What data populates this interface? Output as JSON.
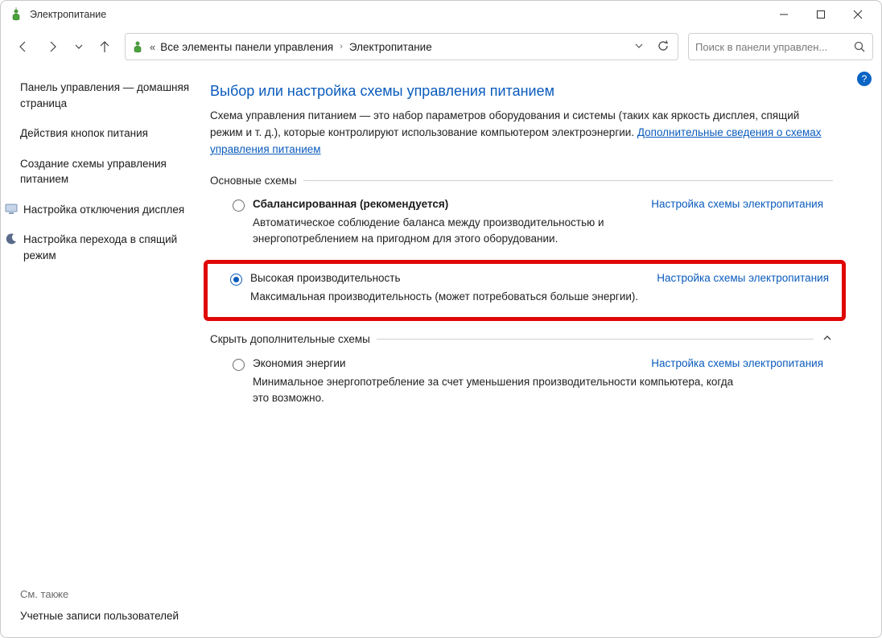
{
  "title": "Электропитание",
  "breadcrumb": {
    "prefix": "«",
    "level1": "Все элементы панели управления",
    "level2": "Электропитание"
  },
  "search": {
    "placeholder": "Поиск в панели управлен..."
  },
  "help_badge": "?",
  "sidebar": {
    "items": [
      {
        "label": "Панель управления — домашняя страница"
      },
      {
        "label": "Действия кнопок питания"
      },
      {
        "label": "Создание схемы управления питанием"
      },
      {
        "label": "Настройка отключения дисплея",
        "icon": "monitor"
      },
      {
        "label": "Настройка перехода в спящий режим",
        "icon": "moon"
      }
    ],
    "see_also_h": "См. также",
    "see_also": "Учетные записи пользователей"
  },
  "page": {
    "title": "Выбор или настройка схемы управления питанием",
    "desc": "Схема управления питанием — это набор параметров оборудования и системы (таких как яркость дисплея, спящий режим и т. д.), которые контролируют использование компьютером электроэнергии.",
    "more_link": "Дополнительные сведения о схемах управления питанием",
    "section1": "Основные схемы",
    "plan_link": "Настройка схемы электропитания",
    "plans": {
      "balanced": {
        "name": "Сбалансированная (рекомендуется)",
        "desc": "Автоматическое соблюдение баланса между производительностью и энергопотреблением на пригодном для этого оборудовании."
      },
      "high": {
        "name": "Высокая производительность",
        "desc": "Максимальная производительность (может потребоваться больше энергии)."
      },
      "save": {
        "name": "Экономия энергии",
        "desc": "Минимальное энергопотребление за счет уменьшения производительности компьютера, когда это возможно."
      }
    },
    "section2": "Скрыть дополнительные схемы"
  }
}
